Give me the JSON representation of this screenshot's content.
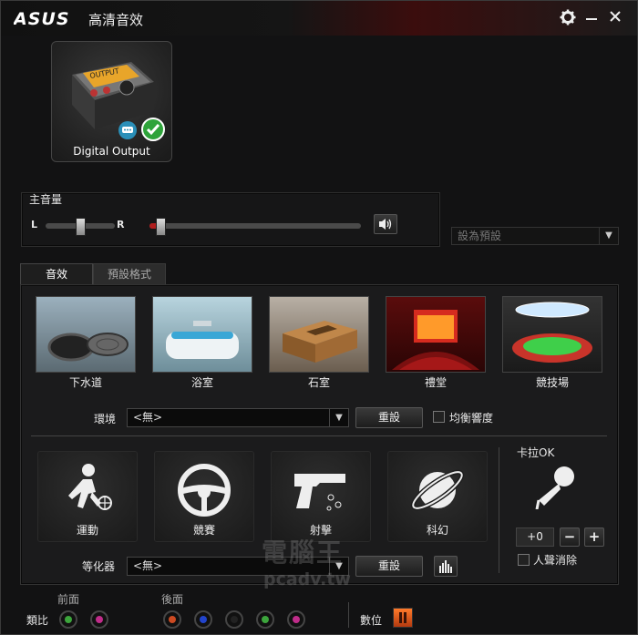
{
  "titlebar": {
    "logo": "/ISUS",
    "title": "高清音效"
  },
  "device": {
    "label": "Digital Output",
    "screen_text": "OUTPUT"
  },
  "volume": {
    "title": "主音量",
    "left": "L",
    "right": "R",
    "balance": 0.5,
    "level": 0.04
  },
  "default_dropdown": {
    "label": "設為預設"
  },
  "tabs": [
    {
      "label": "音效",
      "active": true
    },
    {
      "label": "預設格式",
      "active": false
    }
  ],
  "environments": [
    {
      "label": "下水道"
    },
    {
      "label": "浴室"
    },
    {
      "label": "石室"
    },
    {
      "label": "禮堂"
    },
    {
      "label": "競技場"
    }
  ],
  "environment_row": {
    "label": "環境",
    "value": "<無>",
    "reset": "重設",
    "loudness": "均衡響度"
  },
  "functions": [
    {
      "label": "運動",
      "icon": "runner-icon"
    },
    {
      "label": "競賽",
      "icon": "steering-wheel-icon"
    },
    {
      "label": "射擊",
      "icon": "pistol-icon"
    },
    {
      "label": "科幻",
      "icon": "planet-icon"
    }
  ],
  "karaoke": {
    "title": "卡拉OK",
    "value": "+0",
    "minus": "−",
    "plus": "+",
    "vocal_cancel": "人聲消除"
  },
  "equalizer_row": {
    "label": "等化器",
    "value": "<無>",
    "reset": "重設"
  },
  "watermark": {
    "line1": "電腦王",
    "line2": "pcadv.tw"
  },
  "bottom": {
    "front_label": "前面",
    "rear_label": "後面",
    "analog_label": "類比",
    "digital_label": "數位",
    "front_jacks": [
      "#3ca53c",
      "#c02c8a"
    ],
    "rear_jacks": [
      "#cc4a22",
      "#2244cc",
      "#222222",
      "#3ca53c",
      "#c02c8a"
    ]
  },
  "colors": {
    "accent_red": "#8a1a1a",
    "brand_bg": "#121213"
  }
}
